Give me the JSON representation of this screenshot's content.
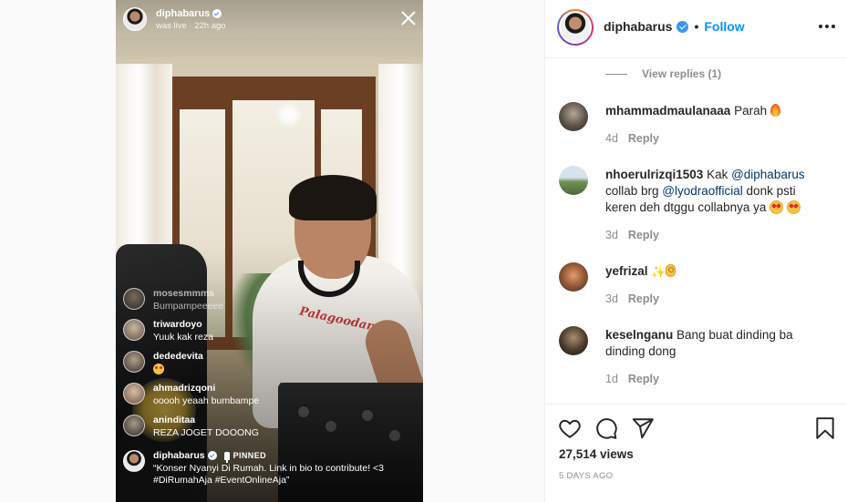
{
  "live": {
    "username": "diphabarus",
    "status": "was live · 22h ago",
    "comments": [
      {
        "user": "mosesmmms",
        "message": "Bumpampeeeee",
        "faded": true
      },
      {
        "user": "triwardoyo",
        "message": "Yuuk kak reza"
      },
      {
        "user": "dededevita",
        "message": ""
      },
      {
        "user": "ahmadrizqoni",
        "message": "ooooh yeaah bumbampe"
      },
      {
        "user": "aninditaa",
        "message": "REZA JOGET DOOONG"
      }
    ],
    "pinned": {
      "user": "diphabarus",
      "tag": "PINNED",
      "message": "“Konser Nyanyi Di Rumah. Link in bio to contribute! <3 #DiRumahAja #EventOnlineAja”"
    }
  },
  "header": {
    "username": "diphabarus",
    "separator": "•",
    "follow_label": "Follow"
  },
  "view_replies": "View replies (1)",
  "comments": [
    {
      "user": "mhammadmaulanaaa",
      "text": "Parah",
      "time": "4d",
      "reply": "Reply"
    },
    {
      "user": "nhoerulrizqi1503",
      "text_pre": "Kak ",
      "mention1": "@diphabarus",
      "text_mid": " collab brg ",
      "mention2": "@lyodraofficial",
      "text_post": " donk psti keren deh dtggu collabnya ya ",
      "time": "3d",
      "reply": "Reply"
    },
    {
      "user": "yefrizal",
      "text": "",
      "time": "3d",
      "reply": "Reply"
    },
    {
      "user": "keselnganu",
      "text": "Bang buat dinding ba dinding dong",
      "time": "1d",
      "reply": "Reply"
    }
  ],
  "stats": {
    "views": "27,514 views",
    "date": "5 DAYS AGO"
  }
}
